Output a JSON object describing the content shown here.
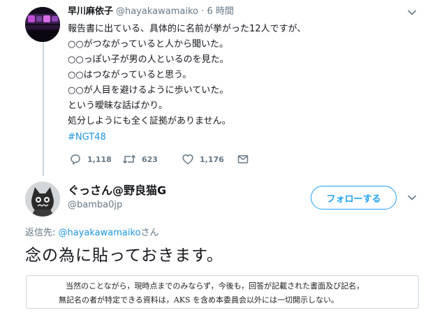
{
  "tweet1": {
    "author_name": "早川麻依子",
    "handle": "@hayakawamaiko",
    "separator": "·",
    "time": "6 時間",
    "lines": [
      "報告書に出ている、具体的に名前が挙がった12人ですが、",
      "○○がつながっていると人から聞いた。",
      "○○っぽい子が男の人といるのを見た。",
      "○○はつながっていると思う。",
      "○○が人目を避けるように歩いていた。",
      "という曖昧な話ばかり。",
      "処分しようにも全く証拠がありません。"
    ],
    "hashtag": "#NGT48",
    "replies": "1,118",
    "retweets": "623",
    "likes": "1,176",
    "icons": [
      "reply-icon",
      "retweet-icon",
      "like-icon",
      "message-icon",
      "chevron-down-icon"
    ]
  },
  "tweet2": {
    "author_name": "ぐっさん@野良猫G",
    "handle": "@bamba0jp",
    "follow_label": "フォローする",
    "reply_prefix": "返信先: ",
    "reply_mention": "@hayakawamaiko",
    "reply_suffix": "さん",
    "text": "念の為に貼っておきます。",
    "document_lines": [
      "当然のことながら，現時点までのみならず，今後も，回答が記載された書面及び記名，",
      "無記名の者が特定できる資料は，AKS を含め本委員会以外には一切開示しない。"
    ]
  },
  "colors": {
    "accent": "#1da1f2",
    "link": "#1b95e0",
    "secondary_text": "#657786",
    "border": "#ccd6dd"
  }
}
